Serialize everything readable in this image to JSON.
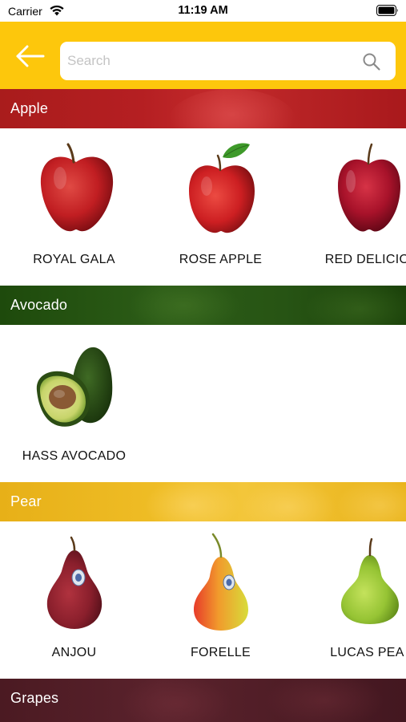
{
  "status_bar": {
    "carrier": "Carrier",
    "time": "11:19 AM"
  },
  "header": {
    "search_placeholder": "Search",
    "search_value": ""
  },
  "categories": [
    {
      "name": "Apple",
      "color": "#b51f22",
      "items": [
        {
          "name": "ROYAL GALA",
          "icon": "apple-image"
        },
        {
          "name": "ROSE APPLE",
          "icon": "apple-with-leaf-image"
        },
        {
          "name": "RED DELICIO",
          "icon": "red-delicious-apple-image"
        }
      ]
    },
    {
      "name": "Avocado",
      "color": "#2c5c17",
      "items": [
        {
          "name": "HASS AVOCADO",
          "icon": "avocado-image"
        }
      ]
    },
    {
      "name": "Pear",
      "color": "#efbd26",
      "items": [
        {
          "name": "ANJOU",
          "icon": "red-pear-image"
        },
        {
          "name": "FORELLE",
          "icon": "forelle-pear-image"
        },
        {
          "name": "LUCAS PEA",
          "icon": "green-pear-image"
        }
      ]
    },
    {
      "name": "Grapes",
      "color": "#5a222c",
      "items": []
    }
  ],
  "colors": {
    "header_bg": "#FDC70C",
    "search_bg": "#ffffff",
    "placeholder": "#c4c4c4"
  }
}
